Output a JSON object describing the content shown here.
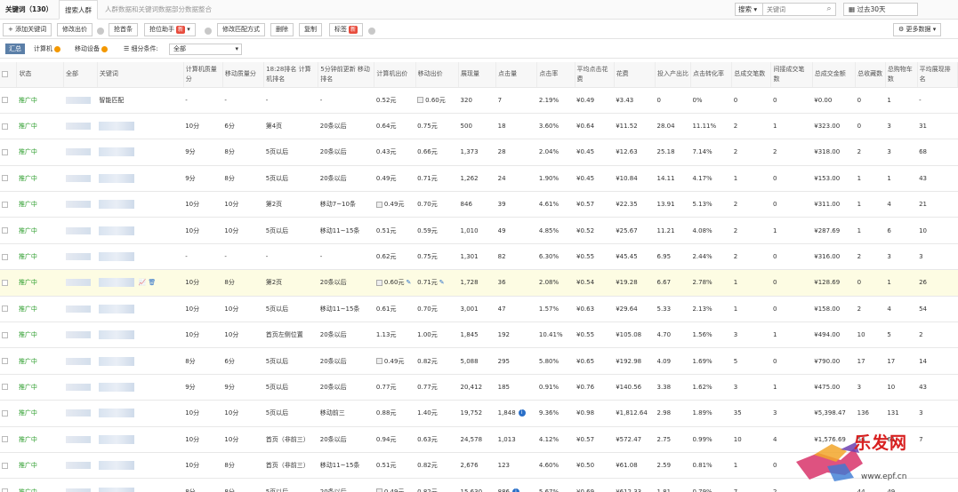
{
  "tabs": {
    "title": "关键词（130）",
    "t1": "搜索人群",
    "t2": "人群数据和关键词数据部分数据整合"
  },
  "search": {
    "type": "搜索",
    "placeholder": "关键词",
    "date": "过去30天"
  },
  "toolbar": {
    "add": "+ 添加关键词",
    "modify_bid": "修改出价",
    "grab": "抢首条",
    "rank_helper": "抢位助手",
    "rank_badge": "新",
    "modify_match": "修改匹配方式",
    "delete": "删除",
    "copy": "复制",
    "tag": "标签",
    "tag_badge": "新",
    "more_data": "更多数据"
  },
  "filters": {
    "summary": "汇总",
    "computer": "计算机",
    "mobile": "移动设备",
    "cond_label": "细分条件:",
    "cond_value": "全部"
  },
  "columns": [
    "状态",
    "全部",
    "关键词",
    "计算机质量分",
    "移动质量分",
    "18:28排名 计算机排名",
    "5分钟前更新 移动排名",
    "计算机出价",
    "移动出价",
    "展现量",
    "点击量",
    "点击率",
    "平均点击花费",
    "花费",
    "投入产出比",
    "点击转化率",
    "总成交笔数",
    "间接成交笔数",
    "总成交金额",
    "总收藏数",
    "总购物车数",
    "平均展现排名"
  ],
  "rows": [
    {
      "status": "推广中",
      "kw": "智能匹配",
      "pcq": "-",
      "mq": "-",
      "pcr": "-",
      "mr": "-",
      "pcb": "0.52元",
      "mb": "0.60元",
      "imp": "320",
      "clk": "7",
      "ctr": "2.19%",
      "cpc": "¥0.49",
      "cost": "¥3.43",
      "roi": "0",
      "cvr": "0%",
      "tot": "0",
      "ind": "0",
      "amt": "¥0.00",
      "fav": "0",
      "cart": "1",
      "avg": "-"
    },
    {
      "status": "推广中",
      "kw": "",
      "pcq": "10分",
      "mq": "6分",
      "pcr": "第4页",
      "mr": "20条以后",
      "pcb": "0.64元",
      "mb": "0.75元",
      "imp": "500",
      "clk": "18",
      "ctr": "3.60%",
      "cpc": "¥0.64",
      "cost": "¥11.52",
      "roi": "28.04",
      "cvr": "11.11%",
      "tot": "2",
      "ind": "1",
      "amt": "¥323.00",
      "fav": "0",
      "cart": "3",
      "avg": "31"
    },
    {
      "status": "推广中",
      "kw": "",
      "pcq": "9分",
      "mq": "8分",
      "pcr": "5页以后",
      "mr": "20条以后",
      "pcb": "0.43元",
      "mb": "0.66元",
      "imp": "1,373",
      "clk": "28",
      "ctr": "2.04%",
      "cpc": "¥0.45",
      "cost": "¥12.63",
      "roi": "25.18",
      "cvr": "7.14%",
      "tot": "2",
      "ind": "2",
      "amt": "¥318.00",
      "fav": "2",
      "cart": "3",
      "avg": "68"
    },
    {
      "status": "推广中",
      "kw": "",
      "pcq": "9分",
      "mq": "8分",
      "pcr": "5页以后",
      "mr": "20条以后",
      "pcb": "0.49元",
      "mb": "0.71元",
      "imp": "1,262",
      "clk": "24",
      "ctr": "1.90%",
      "cpc": "¥0.45",
      "cost": "¥10.84",
      "roi": "14.11",
      "cvr": "4.17%",
      "tot": "1",
      "ind": "0",
      "amt": "¥153.00",
      "fav": "1",
      "cart": "1",
      "avg": "43"
    },
    {
      "status": "推广中",
      "kw": "",
      "pcq": "10分",
      "mq": "10分",
      "pcr": "第2页",
      "mr": "移动7~10条",
      "pcb": "0.49元",
      "mb": "0.70元",
      "imp": "846",
      "clk": "39",
      "ctr": "4.61%",
      "cpc": "¥0.57",
      "cost": "¥22.35",
      "roi": "13.91",
      "cvr": "5.13%",
      "tot": "2",
      "ind": "0",
      "amt": "¥311.00",
      "fav": "1",
      "cart": "4",
      "avg": "21"
    },
    {
      "status": "推广中",
      "kw": "",
      "pcq": "10分",
      "mq": "10分",
      "pcr": "5页以后",
      "mr": "移动11~15条",
      "pcb": "0.51元",
      "mb": "0.59元",
      "imp": "1,010",
      "clk": "49",
      "ctr": "4.85%",
      "cpc": "¥0.52",
      "cost": "¥25.67",
      "roi": "11.21",
      "cvr": "4.08%",
      "tot": "2",
      "ind": "1",
      "amt": "¥287.69",
      "fav": "1",
      "cart": "6",
      "avg": "10"
    },
    {
      "status": "推广中",
      "kw": "",
      "pcq": "-",
      "mq": "-",
      "pcr": "-",
      "mr": "-",
      "pcb": "0.62元",
      "mb": "0.75元",
      "imp": "1,301",
      "clk": "82",
      "ctr": "6.30%",
      "cpc": "¥0.55",
      "cost": "¥45.45",
      "roi": "6.95",
      "cvr": "2.44%",
      "tot": "2",
      "ind": "0",
      "amt": "¥316.00",
      "fav": "2",
      "cart": "3",
      "avg": "3"
    },
    {
      "status": "推广中",
      "kw": "",
      "pcq": "10分",
      "mq": "8分",
      "pcr": "第2页",
      "mr": "20条以后",
      "pcb": "0.60元",
      "mb": "0.71元",
      "imp": "1,728",
      "clk": "36",
      "ctr": "2.08%",
      "cpc": "¥0.54",
      "cost": "¥19.28",
      "roi": "6.67",
      "cvr": "2.78%",
      "tot": "1",
      "ind": "0",
      "amt": "¥128.69",
      "fav": "0",
      "cart": "1",
      "avg": "26"
    },
    {
      "status": "推广中",
      "kw": "",
      "pcq": "10分",
      "mq": "10分",
      "pcr": "5页以后",
      "mr": "移动11~15条",
      "pcb": "0.61元",
      "mb": "0.70元",
      "imp": "3,001",
      "clk": "47",
      "ctr": "1.57%",
      "cpc": "¥0.63",
      "cost": "¥29.64",
      "roi": "5.33",
      "cvr": "2.13%",
      "tot": "1",
      "ind": "0",
      "amt": "¥158.00",
      "fav": "2",
      "cart": "4",
      "avg": "54"
    },
    {
      "status": "推广中",
      "kw": "",
      "pcq": "10分",
      "mq": "10分",
      "pcr": "首页左侧位置",
      "mr": "20条以后",
      "pcb": "1.13元",
      "mb": "1.00元",
      "imp": "1,845",
      "clk": "192",
      "ctr": "10.41%",
      "cpc": "¥0.55",
      "cost": "¥105.08",
      "roi": "4.70",
      "cvr": "1.56%",
      "tot": "3",
      "ind": "1",
      "amt": "¥494.00",
      "fav": "10",
      "cart": "5",
      "avg": "2"
    },
    {
      "status": "推广中",
      "kw": "",
      "pcq": "8分",
      "mq": "6分",
      "pcr": "5页以后",
      "mr": "20条以后",
      "pcb": "0.49元",
      "mb": "0.82元",
      "imp": "5,088",
      "clk": "295",
      "ctr": "5.80%",
      "cpc": "¥0.65",
      "cost": "¥192.98",
      "roi": "4.09",
      "cvr": "1.69%",
      "tot": "5",
      "ind": "0",
      "amt": "¥790.00",
      "fav": "17",
      "cart": "17",
      "avg": "14"
    },
    {
      "status": "推广中",
      "kw": "",
      "pcq": "9分",
      "mq": "9分",
      "pcr": "5页以后",
      "mr": "20条以后",
      "pcb": "0.77元",
      "mb": "0.77元",
      "imp": "20,412",
      "clk": "185",
      "ctr": "0.91%",
      "cpc": "¥0.76",
      "cost": "¥140.56",
      "roi": "3.38",
      "cvr": "1.62%",
      "tot": "3",
      "ind": "1",
      "amt": "¥475.00",
      "fav": "3",
      "cart": "10",
      "avg": "43"
    },
    {
      "status": "推广中",
      "kw": "",
      "pcq": "10分",
      "mq": "10分",
      "pcr": "5页以后",
      "mr": "移动前三",
      "pcb": "0.88元",
      "mb": "1.40元",
      "imp": "19,752",
      "clk": "1,848",
      "ctr": "9.36%",
      "cpc": "¥0.98",
      "cost": "¥1,812.64",
      "roi": "2.98",
      "cvr": "1.89%",
      "tot": "35",
      "ind": "3",
      "amt": "¥5,398.47",
      "fav": "136",
      "cart": "131",
      "avg": "3"
    },
    {
      "status": "推广中",
      "kw": "",
      "pcq": "10分",
      "mq": "10分",
      "pcr": "首页（非前三）",
      "mr": "20条以后",
      "pcb": "0.94元",
      "mb": "0.63元",
      "imp": "24,578",
      "clk": "1,013",
      "ctr": "4.12%",
      "cpc": "¥0.57",
      "cost": "¥572.47",
      "roi": "2.75",
      "cvr": "0.99%",
      "tot": "10",
      "ind": "4",
      "amt": "¥1,576.69",
      "fav": "54",
      "cart": "61",
      "avg": "7"
    },
    {
      "status": "推广中",
      "kw": "",
      "pcq": "10分",
      "mq": "8分",
      "pcr": "首页（非前三）",
      "mr": "移动11~15条",
      "pcb": "0.51元",
      "mb": "0.82元",
      "imp": "2,676",
      "clk": "123",
      "ctr": "4.60%",
      "cpc": "¥0.50",
      "cost": "¥61.08",
      "roi": "2.59",
      "cvr": "0.81%",
      "tot": "1",
      "ind": "0",
      "amt": "",
      "fav": "",
      "cart": "",
      "avg": ""
    },
    {
      "status": "推广中",
      "kw": "",
      "pcq": "8分",
      "mq": "8分",
      "pcr": "5页以后",
      "mr": "20条以后",
      "pcb": "0.49元",
      "mb": "0.82元",
      "imp": "15,630",
      "clk": "886",
      "ctr": "5.67%",
      "cpc": "¥0.69",
      "cost": "¥612.33",
      "roi": "1.81",
      "cvr": "0.79%",
      "tot": "7",
      "ind": "2",
      "amt": "",
      "fav": "44",
      "cart": "49",
      "avg": ""
    }
  ],
  "watermark": {
    "text": "乐发网",
    "url": "www.epf.cn"
  }
}
